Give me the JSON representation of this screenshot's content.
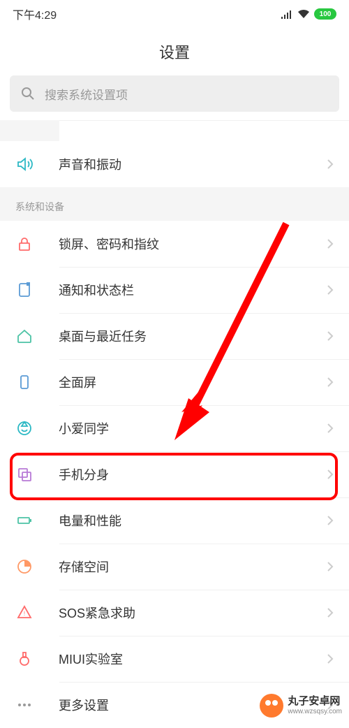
{
  "status": {
    "time": "下午4:29",
    "battery": "100"
  },
  "header": {
    "title": "设置"
  },
  "search": {
    "placeholder": "搜索系统设置项"
  },
  "section1": {
    "items": [
      {
        "label": "声音和振动"
      }
    ]
  },
  "section2": {
    "title": "系统和设备",
    "items": [
      {
        "label": "锁屏、密码和指纹"
      },
      {
        "label": "通知和状态栏"
      },
      {
        "label": "桌面与最近任务"
      },
      {
        "label": "全面屏"
      },
      {
        "label": "小爱同学"
      },
      {
        "label": "手机分身"
      },
      {
        "label": "电量和性能"
      },
      {
        "label": "存储空间"
      },
      {
        "label": "SOS紧急求助"
      },
      {
        "label": "MIUI实验室"
      },
      {
        "label": "更多设置"
      }
    ]
  },
  "watermark": {
    "title": "丸子安卓网",
    "url": "www.wzsqsy.com"
  }
}
